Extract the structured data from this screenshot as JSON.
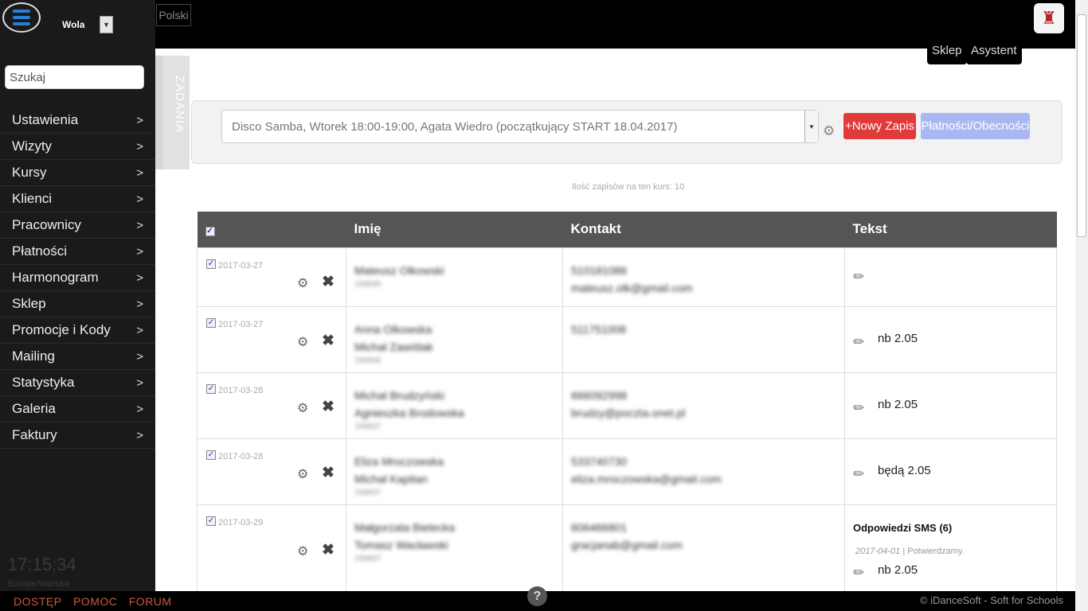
{
  "sidebar": {
    "branch": "Wola",
    "search_placeholder": "Szukaj",
    "items": [
      {
        "label": "Ustawienia"
      },
      {
        "label": "Wizyty"
      },
      {
        "label": "Kursy"
      },
      {
        "label": "Klienci"
      },
      {
        "label": "Pracownicy"
      },
      {
        "label": "Płatności"
      },
      {
        "label": "Harmonogram"
      },
      {
        "label": "Sklep"
      },
      {
        "label": "Promocje i Kody"
      },
      {
        "label": "Mailing"
      },
      {
        "label": "Statystyka"
      },
      {
        "label": "Galeria"
      },
      {
        "label": "Faktury"
      }
    ],
    "chevron": ">",
    "clock": "17:15:34",
    "timezone": "Europe/Warsaw"
  },
  "topbar": {
    "language": "Polski",
    "shop_tab": "Sklep",
    "assistant_tab": "Asystent"
  },
  "tasks_tab": "ZADANIA",
  "course": {
    "selected": "Disco Samba, Wtorek 18:00-19:00, Agata Wiedro (początkujący START 18.04.2017)",
    "new_button": "+Nowy Zapis",
    "payments_button": "Płatności/Obecności",
    "count_text": "Ilość zapisów na ten kurs: 10"
  },
  "table": {
    "headers": [
      "Imię",
      "Kontakt",
      "Tekst"
    ],
    "rows": [
      {
        "date": "2017-03-27",
        "names": [
          "Mateusz Olkowski"
        ],
        "id": "156836",
        "contact": [
          "510181086",
          "mateusz.olk@gmail.com"
        ],
        "note": "",
        "sms": null
      },
      {
        "date": "2017-03-27",
        "names": [
          "Anna Olkowska",
          "Michał Zawiślak"
        ],
        "id": "156836",
        "contact": [
          "511751008"
        ],
        "note": "nb 2.05",
        "sms": null
      },
      {
        "date": "2017-03-28",
        "names": [
          "Michał Brudzyński",
          "Agnieszka Brodowska"
        ],
        "id": "156837",
        "contact": [
          "666092998",
          "brudzy@poczta.onet.pl"
        ],
        "note": "nb 2.05",
        "sms": null
      },
      {
        "date": "2017-03-28",
        "names": [
          "Eliza Mroczowska",
          "Michał Kapitan"
        ],
        "id": "156837",
        "contact": [
          "533740730",
          "eliza.mroczowska@gmail.com"
        ],
        "note": "będą 2.05",
        "sms": null
      },
      {
        "date": "2017-03-29",
        "names": [
          "Małgorzata Bielecka",
          "Tomasz Wacławski"
        ],
        "id": "156837",
        "contact": [
          "606466801",
          "gracjanab@gmail.com"
        ],
        "note": "nb 2.05",
        "sms": {
          "title": "Odpowiedzi SMS (6)",
          "date": "2017-04-01",
          "text": "| Potwierdzamy."
        }
      }
    ]
  },
  "footer": {
    "links": [
      "DOSTĘP",
      "POMOC",
      "FORUM"
    ],
    "help": "?",
    "copyright": "© iDanceSoft - Soft for Schools"
  }
}
